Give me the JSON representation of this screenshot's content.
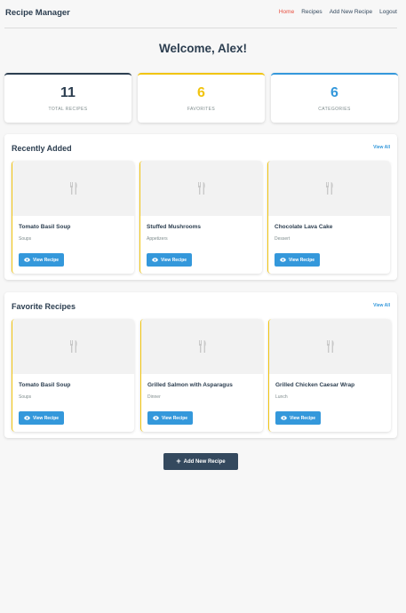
{
  "header": {
    "brand": "Recipe Manager",
    "nav": [
      {
        "label": "Home",
        "active": true
      },
      {
        "label": "Recipes",
        "active": false
      },
      {
        "label": "Add New Recipe",
        "active": false
      },
      {
        "label": "Logout",
        "active": false
      }
    ]
  },
  "welcome": "Welcome, Alex!",
  "stats": [
    {
      "value": "11",
      "label": "TOTAL RECIPES",
      "color": "#2c3e50"
    },
    {
      "value": "6",
      "label": "FAVORITES",
      "color": "#f1c40f"
    },
    {
      "value": "6",
      "label": "CATEGORIES",
      "color": "#3498db"
    }
  ],
  "recent": {
    "title": "Recently Added",
    "view_all": "View All",
    "cards": [
      {
        "name": "Tomato Basil Soup",
        "category": "Soups",
        "button": "View Recipe"
      },
      {
        "name": "Stuffed Mushrooms",
        "category": "Appetizers",
        "button": "View Recipe"
      },
      {
        "name": "Chocolate Lava Cake",
        "category": "Dessert",
        "button": "View Recipe"
      }
    ]
  },
  "favorites": {
    "title": "Favorite Recipes",
    "view_all": "View All",
    "cards": [
      {
        "name": "Tomato Basil Soup",
        "category": "Soups",
        "button": "View Recipe"
      },
      {
        "name": "Grilled Salmon with Asparagus",
        "category": "Dinner",
        "button": "View Recipe"
      },
      {
        "name": "Grilled Chicken Caesar Wrap",
        "category": "Lunch",
        "button": "View Recipe"
      }
    ]
  },
  "add_button": "Add New Recipe",
  "icons": {
    "card_image": "utensils-icon",
    "view": "eye-icon",
    "add": "plus-icon"
  }
}
